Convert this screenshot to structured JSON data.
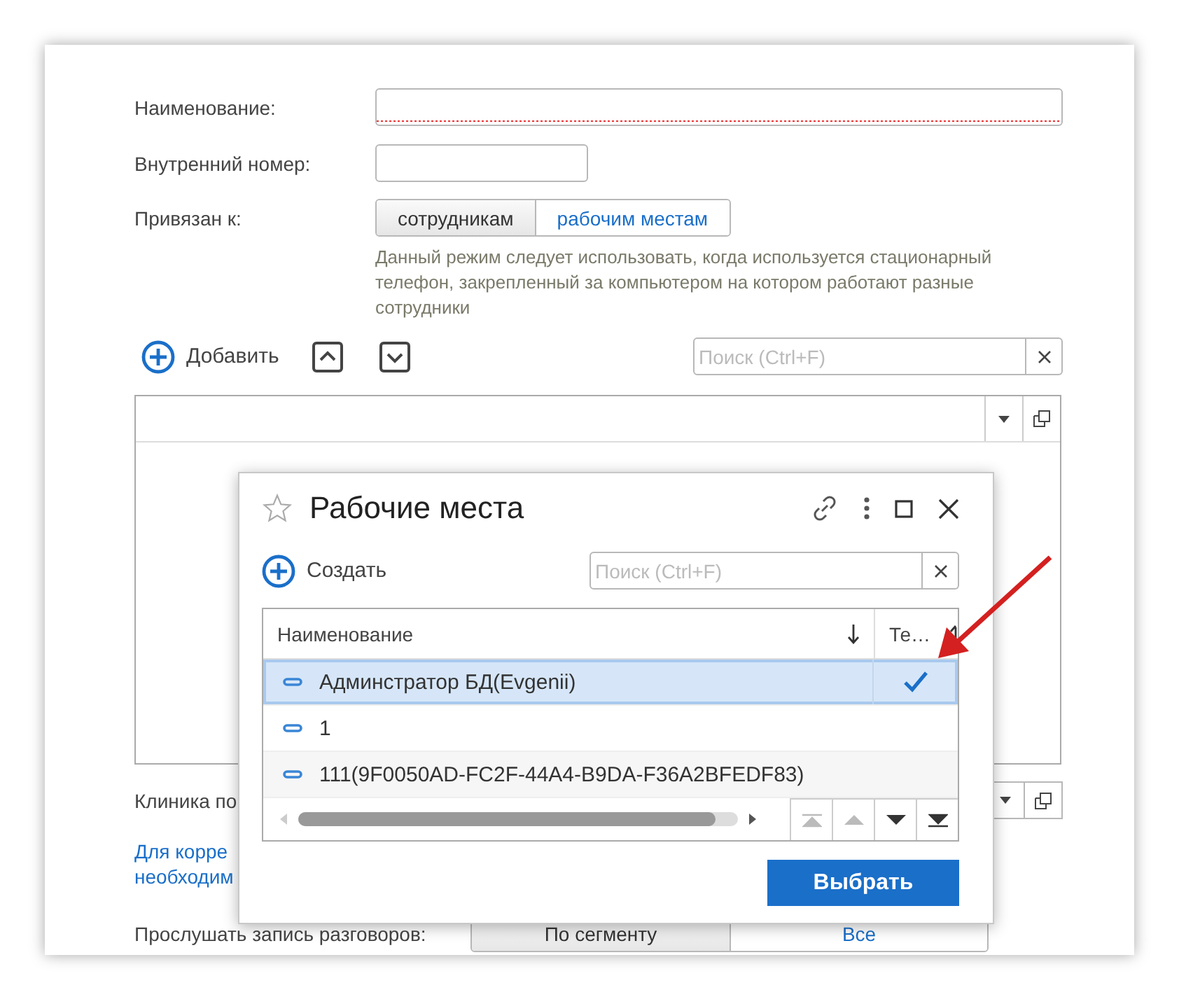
{
  "form": {
    "fields": [
      {
        "label": "Наименование:",
        "kind": "wide",
        "required": true
      },
      {
        "label": "Внутренний номер:",
        "kind": "short",
        "required": false
      }
    ],
    "binding": {
      "label": "Привязан к:",
      "options": [
        {
          "label": "сотрудникам",
          "selected": true
        },
        {
          "label": "рабочим местам",
          "selected": false
        }
      ],
      "hint": "Данный режим следует использовать, когда используется стационарный телефон, закрепленный за компьютером на котором работают разные сотрудники"
    },
    "toolbar": {
      "add": "Добавить",
      "search_placeholder": "Поиск (Ctrl+F)"
    },
    "clinic_label": "Клиника по",
    "note_lines": [
      "Для корре",
      "необходим"
    ],
    "listen": {
      "label": "Прослушать запись разговоров:",
      "options": [
        {
          "label": "По сегменту",
          "selected": true
        },
        {
          "label": "Все",
          "selected": false
        }
      ]
    }
  },
  "dialog": {
    "title": "Рабочие места",
    "create": "Создать",
    "search_placeholder": "Поиск (Ctrl+F)",
    "columns": [
      "Наименование",
      "Те…"
    ],
    "rows": [
      {
        "name": "Админстратор БД(Evgenii)",
        "checked": true,
        "selected": true
      },
      {
        "name": "1",
        "checked": false,
        "selected": false
      },
      {
        "name": "111(9F0050AD-FC2F-44A4-B9DA-F36A2BFEDF83)",
        "checked": false,
        "selected": false
      }
    ],
    "choose": "Выбрать"
  }
}
